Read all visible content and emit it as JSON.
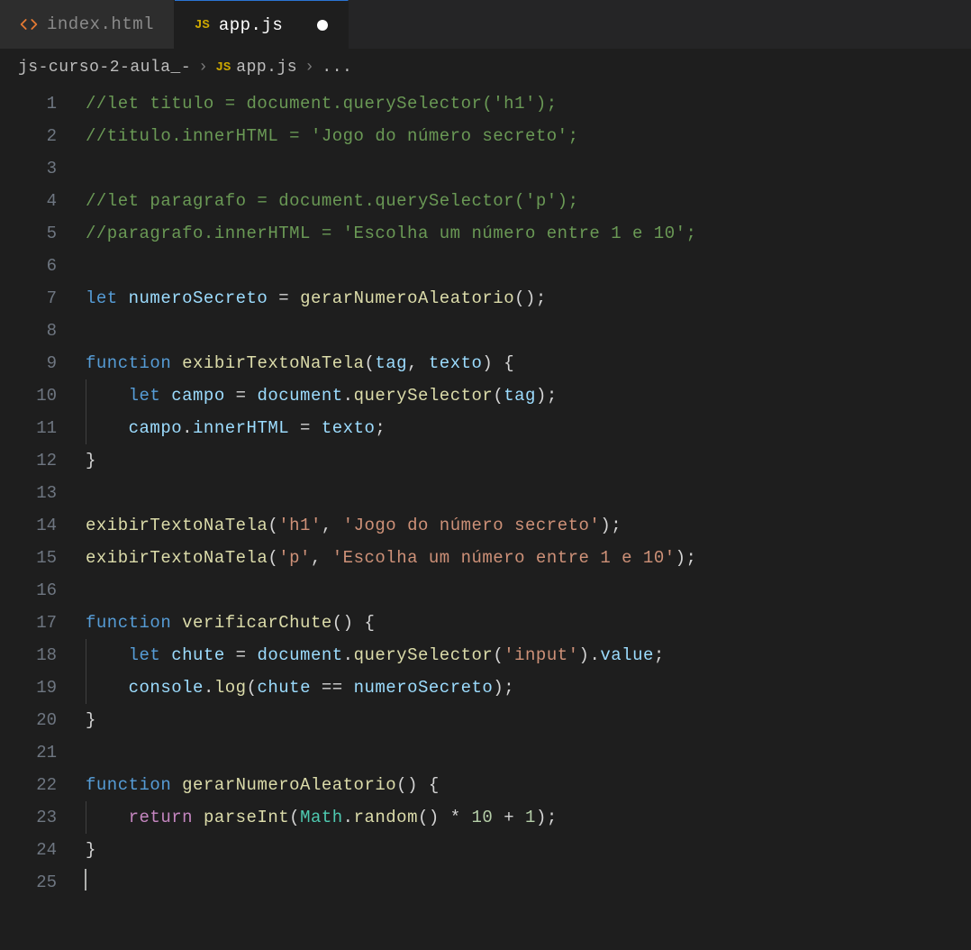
{
  "tabs": [
    {
      "label": "index.html",
      "icon": "html-tag-icon"
    },
    {
      "label": "app.js",
      "icon": "js-icon"
    }
  ],
  "breadcrumbs": {
    "item0": "js-curso-2-aula_-",
    "item1_icon": "JS",
    "item1": "app.js",
    "item2": "..."
  },
  "lines": {
    "l1": {
      "num": "1",
      "tokens": [
        {
          "t": "//let titulo = document.querySelector('h1');",
          "c": "c-comment"
        }
      ]
    },
    "l2": {
      "num": "2",
      "tokens": [
        {
          "t": "//titulo.innerHTML = 'Jogo do número secreto';",
          "c": "c-comment"
        }
      ]
    },
    "l3": {
      "num": "3",
      "tokens": []
    },
    "l4": {
      "num": "4",
      "tokens": [
        {
          "t": "//let paragrafo = document.querySelector('p');",
          "c": "c-comment"
        }
      ]
    },
    "l5": {
      "num": "5",
      "tokens": [
        {
          "t": "//paragrafo.innerHTML = 'Escolha um número entre 1 e 10';",
          "c": "c-comment"
        }
      ]
    },
    "l6": {
      "num": "6",
      "tokens": []
    },
    "l7": {
      "num": "7",
      "tokens": [
        {
          "t": "let ",
          "c": "c-keyword"
        },
        {
          "t": "numeroSecreto",
          "c": "c-ident"
        },
        {
          "t": " = ",
          "c": "c-punct"
        },
        {
          "t": "gerarNumeroAleatorio",
          "c": "c-func"
        },
        {
          "t": "();",
          "c": "c-punct"
        }
      ]
    },
    "l8": {
      "num": "8",
      "tokens": []
    },
    "l9": {
      "num": "9",
      "tokens": [
        {
          "t": "function ",
          "c": "c-keyword"
        },
        {
          "t": "exibirTextoNaTela",
          "c": "c-func"
        },
        {
          "t": "(",
          "c": "c-punct"
        },
        {
          "t": "tag",
          "c": "c-ident"
        },
        {
          "t": ", ",
          "c": "c-punct"
        },
        {
          "t": "texto",
          "c": "c-ident"
        },
        {
          "t": ") {",
          "c": "c-punct"
        }
      ]
    },
    "l10": {
      "num": "10",
      "indent": 1,
      "tokens": [
        {
          "t": "let ",
          "c": "c-keyword"
        },
        {
          "t": "campo",
          "c": "c-ident"
        },
        {
          "t": " = ",
          "c": "c-punct"
        },
        {
          "t": "document",
          "c": "c-ident"
        },
        {
          "t": ".",
          "c": "c-punct"
        },
        {
          "t": "querySelector",
          "c": "c-func"
        },
        {
          "t": "(",
          "c": "c-punct"
        },
        {
          "t": "tag",
          "c": "c-ident"
        },
        {
          "t": ");",
          "c": "c-punct"
        }
      ]
    },
    "l11": {
      "num": "11",
      "indent": 1,
      "tokens": [
        {
          "t": "campo",
          "c": "c-ident"
        },
        {
          "t": ".",
          "c": "c-punct"
        },
        {
          "t": "innerHTML",
          "c": "c-ident"
        },
        {
          "t": " = ",
          "c": "c-punct"
        },
        {
          "t": "texto",
          "c": "c-ident"
        },
        {
          "t": ";",
          "c": "c-punct"
        }
      ]
    },
    "l12": {
      "num": "12",
      "tokens": [
        {
          "t": "}",
          "c": "c-punct"
        }
      ]
    },
    "l13": {
      "num": "13",
      "tokens": []
    },
    "l14": {
      "num": "14",
      "tokens": [
        {
          "t": "exibirTextoNaTela",
          "c": "c-func"
        },
        {
          "t": "(",
          "c": "c-punct"
        },
        {
          "t": "'h1'",
          "c": "c-str"
        },
        {
          "t": ", ",
          "c": "c-punct"
        },
        {
          "t": "'Jogo do número secreto'",
          "c": "c-str"
        },
        {
          "t": ");",
          "c": "c-punct"
        }
      ]
    },
    "l15": {
      "num": "15",
      "tokens": [
        {
          "t": "exibirTextoNaTela",
          "c": "c-func"
        },
        {
          "t": "(",
          "c": "c-punct"
        },
        {
          "t": "'p'",
          "c": "c-str"
        },
        {
          "t": ", ",
          "c": "c-punct"
        },
        {
          "t": "'Escolha um número entre 1 e 10'",
          "c": "c-str"
        },
        {
          "t": ");",
          "c": "c-punct"
        }
      ]
    },
    "l16": {
      "num": "16",
      "tokens": []
    },
    "l17": {
      "num": "17",
      "tokens": [
        {
          "t": "function ",
          "c": "c-keyword"
        },
        {
          "t": "verificarChute",
          "c": "c-func"
        },
        {
          "t": "() {",
          "c": "c-punct"
        }
      ]
    },
    "l18": {
      "num": "18",
      "indent": 1,
      "tokens": [
        {
          "t": "let ",
          "c": "c-keyword"
        },
        {
          "t": "chute",
          "c": "c-ident"
        },
        {
          "t": " = ",
          "c": "c-punct"
        },
        {
          "t": "document",
          "c": "c-ident"
        },
        {
          "t": ".",
          "c": "c-punct"
        },
        {
          "t": "querySelector",
          "c": "c-func"
        },
        {
          "t": "(",
          "c": "c-punct"
        },
        {
          "t": "'input'",
          "c": "c-str"
        },
        {
          "t": ").",
          "c": "c-punct"
        },
        {
          "t": "value",
          "c": "c-ident"
        },
        {
          "t": ";",
          "c": "c-punct"
        }
      ]
    },
    "l19": {
      "num": "19",
      "indent": 1,
      "tokens": [
        {
          "t": "console",
          "c": "c-ident"
        },
        {
          "t": ".",
          "c": "c-punct"
        },
        {
          "t": "log",
          "c": "c-func"
        },
        {
          "t": "(",
          "c": "c-punct"
        },
        {
          "t": "chute",
          "c": "c-ident"
        },
        {
          "t": " == ",
          "c": "c-punct"
        },
        {
          "t": "numeroSecreto",
          "c": "c-ident"
        },
        {
          "t": ");",
          "c": "c-punct"
        }
      ]
    },
    "l20": {
      "num": "20",
      "tokens": [
        {
          "t": "}",
          "c": "c-punct"
        }
      ]
    },
    "l21": {
      "num": "21",
      "tokens": []
    },
    "l22": {
      "num": "22",
      "tokens": [
        {
          "t": "function ",
          "c": "c-keyword"
        },
        {
          "t": "gerarNumeroAleatorio",
          "c": "c-func"
        },
        {
          "t": "() {",
          "c": "c-punct"
        }
      ]
    },
    "l23": {
      "num": "23",
      "indent": 1,
      "tokens": [
        {
          "t": "return ",
          "c": "c-control"
        },
        {
          "t": "parseInt",
          "c": "c-func"
        },
        {
          "t": "(",
          "c": "c-punct"
        },
        {
          "t": "Math",
          "c": "c-class"
        },
        {
          "t": ".",
          "c": "c-punct"
        },
        {
          "t": "random",
          "c": "c-func"
        },
        {
          "t": "() * ",
          "c": "c-punct"
        },
        {
          "t": "10",
          "c": "c-num"
        },
        {
          "t": " + ",
          "c": "c-punct"
        },
        {
          "t": "1",
          "c": "c-num"
        },
        {
          "t": ");",
          "c": "c-punct"
        }
      ]
    },
    "l24": {
      "num": "24",
      "tokens": [
        {
          "t": "}",
          "c": "c-punct"
        }
      ]
    },
    "l25": {
      "num": "25",
      "tokens": [],
      "cursor": true
    }
  }
}
